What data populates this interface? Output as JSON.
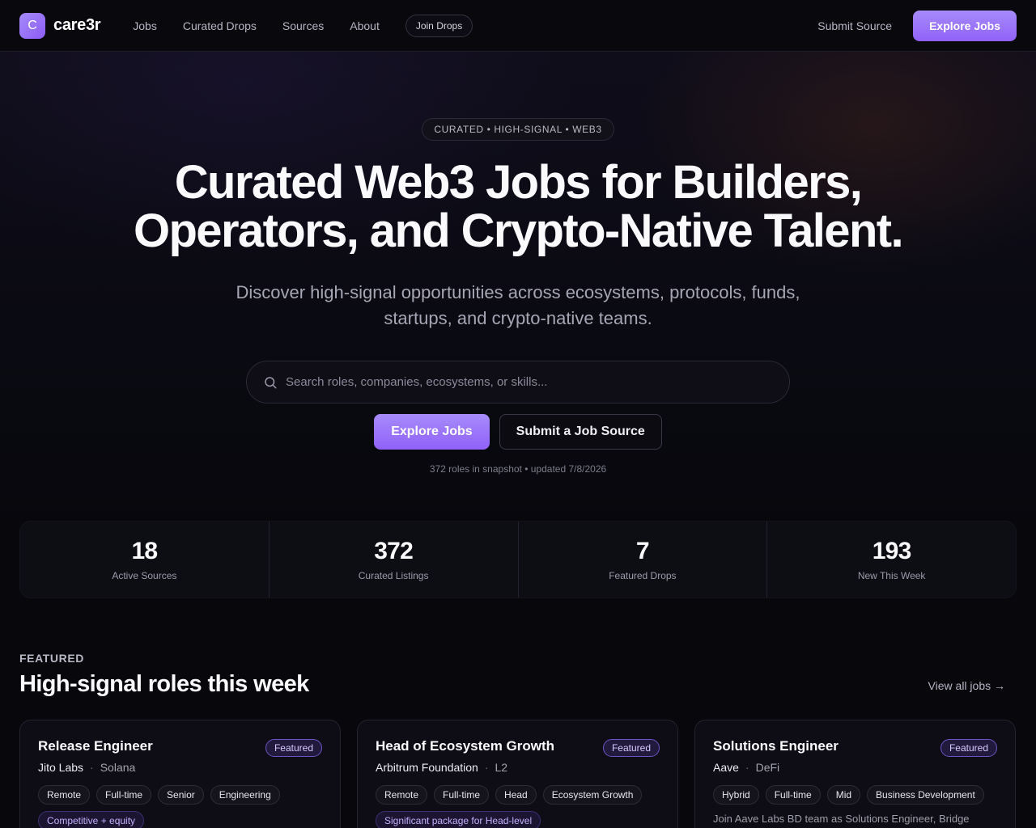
{
  "nav": {
    "logo_letter": "C",
    "logo_text": "care3r",
    "links": [
      "Jobs",
      "Curated Drops",
      "Sources",
      "About"
    ],
    "join_drops": "Join Drops",
    "submit_source": "Submit Source",
    "explore_jobs": "Explore Jobs"
  },
  "hero": {
    "tag": "CURATED • HIGH-SIGNAL • WEB3",
    "title_line1": "Curated Web3 Jobs for Builders,",
    "title_line2": "Operators, and Crypto-Native Talent.",
    "subtitle": "Discover high-signal opportunities across ecosystems, protocols, funds, startups, and crypto-native teams.",
    "search_placeholder": "Search roles, companies, ecosystems, or skills...",
    "primary_cta": "Explore Jobs",
    "secondary_cta": "Submit a Job Source",
    "meta": "372 roles in snapshot • updated 7/8/2026"
  },
  "stats": [
    {
      "value": "18",
      "label": "Active Sources"
    },
    {
      "value": "372",
      "label": "Curated Listings"
    },
    {
      "value": "7",
      "label": "Featured Drops"
    },
    {
      "value": "193",
      "label": "New This Week"
    }
  ],
  "featured": {
    "eyebrow": "FEATURED",
    "title": "High-signal roles this week",
    "view_all": "View all jobs →",
    "cards": [
      {
        "title": "Release Engineer",
        "badge": "Featured",
        "company": "Jito Labs",
        "ecosystem": "Solana",
        "tags": [
          "Remote",
          "Full-time",
          "Senior",
          "Engineering"
        ],
        "comp": "Competitive + equity",
        "desc": ""
      },
      {
        "title": "Head of Ecosystem Growth",
        "badge": "Featured",
        "company": "Arbitrum Foundation",
        "ecosystem": "L2",
        "tags": [
          "Remote",
          "Full-time",
          "Head",
          "Ecosystem Growth"
        ],
        "comp": "Significant package for Head-level",
        "desc": ""
      },
      {
        "title": "Solutions Engineer",
        "badge": "Featured",
        "company": "Aave",
        "ecosystem": "DeFi",
        "tags": [
          "Hybrid",
          "Full-time",
          "Mid",
          "Business Development"
        ],
        "comp": "",
        "desc": "Join Aave Labs BD team as Solutions Engineer, Bridge"
      }
    ]
  },
  "colors": {
    "accent": "#a78bfa",
    "background": "#07070c",
    "card": "#0e0d15"
  }
}
